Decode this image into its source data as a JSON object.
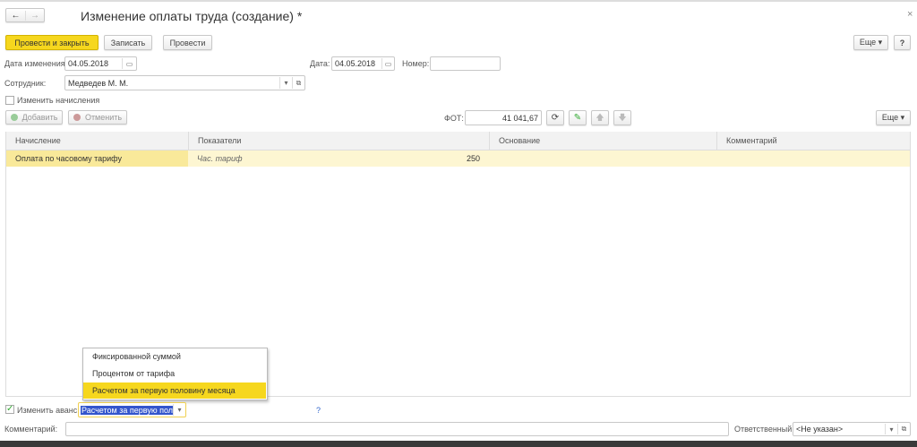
{
  "window": {
    "title": "Изменение оплаты труда (создание) *",
    "close": "×"
  },
  "nav": {
    "back": "←",
    "forward": "→"
  },
  "toolbar": {
    "post_close": "Провести и закрыть",
    "save": "Записать",
    "post": "Провести",
    "more": "Еще ▾",
    "help": "?"
  },
  "form": {
    "change_date_label": "Дата изменения:",
    "change_date": "04.05.2018",
    "date_label": "Дата:",
    "date": "04.05.2018",
    "number_label": "Номер:",
    "number": "",
    "employee_label": "Сотрудник:",
    "employee": "Медведев М. М.",
    "change_accruals_label": "Изменить начисления"
  },
  "table_toolbar": {
    "add": "Добавить",
    "cancel": "Отменить",
    "fot_label": "ФОТ:",
    "fot": "41 041,67",
    "more": "Еще ▾"
  },
  "table": {
    "headers": [
      "Начисление",
      "Показатели",
      "Основание",
      "Комментарий"
    ],
    "rows": [
      {
        "accrual": "Оплата по часовому тарифу",
        "indicator": "Час. тариф",
        "value": "250",
        "basis": "",
        "comment": ""
      }
    ]
  },
  "dropdown": {
    "options": [
      "Фиксированной суммой",
      "Процентом от тарифа",
      "Расчетом за первую половину месяца"
    ],
    "selected_index": 2
  },
  "advance": {
    "checkbox_label": "Изменить аванс",
    "checked": true,
    "value": "Расчетом за первую поло",
    "help": "?"
  },
  "footer": {
    "comment_label": "Комментарий:",
    "comment": "",
    "responsible_label": "Ответственный:",
    "responsible": "<Не указан>"
  },
  "colors": {
    "accent": "#f6d71e",
    "row": "#fdf6d2",
    "selection": "#3355cc"
  }
}
